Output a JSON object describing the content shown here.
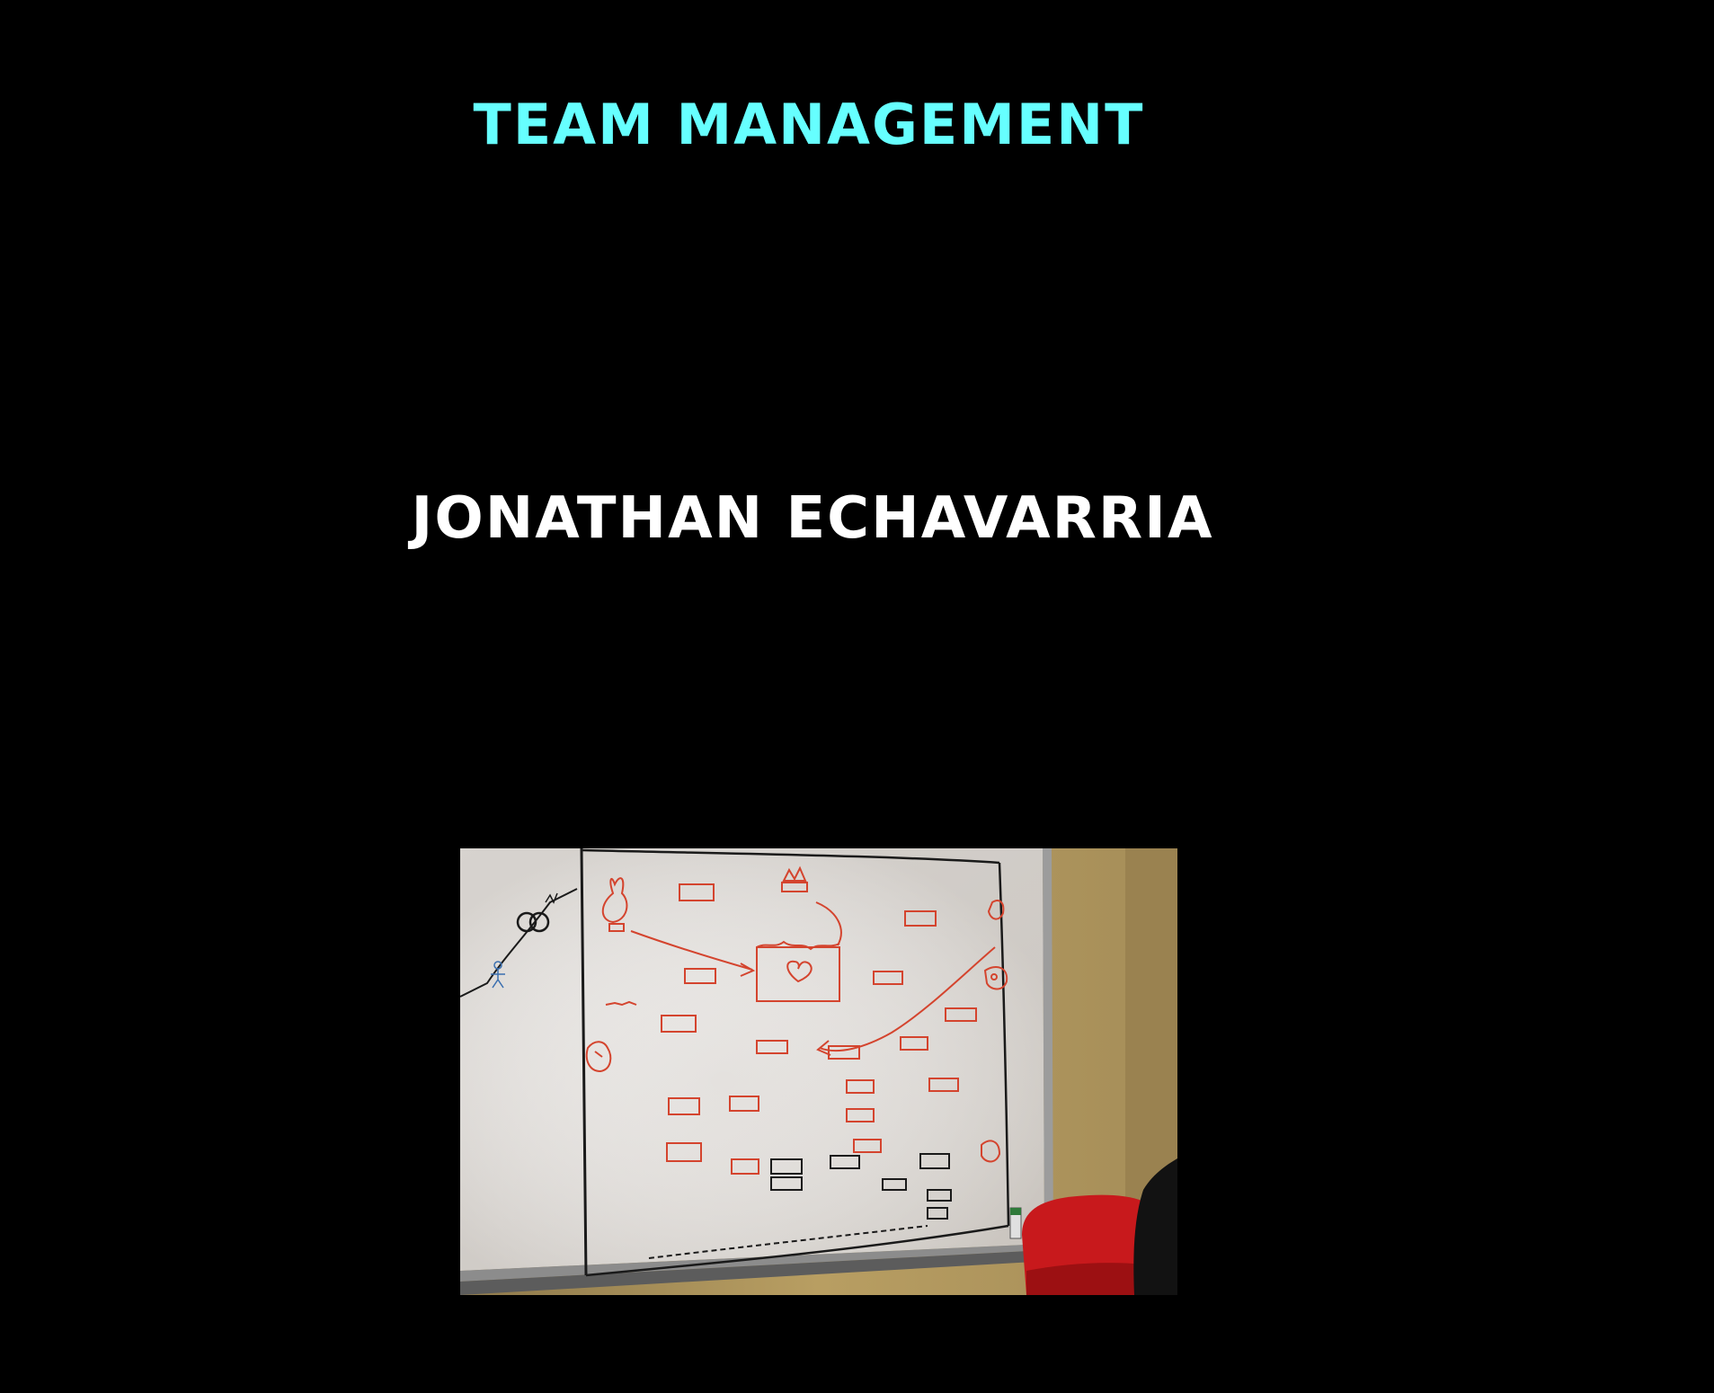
{
  "slide": {
    "title": "Team Management",
    "name": "Jonathan Echavarria"
  },
  "photo": {
    "subject": "whiteboard-sketch"
  },
  "colors": {
    "background": "#000000",
    "title": "#66FFFF",
    "name": "#FFFFFF",
    "sketch_red": "#D4442E",
    "sketch_black": "#1A1A1A",
    "board": "#E9E6E3",
    "wall": "#B69A5C",
    "chair": "#C8191C"
  }
}
